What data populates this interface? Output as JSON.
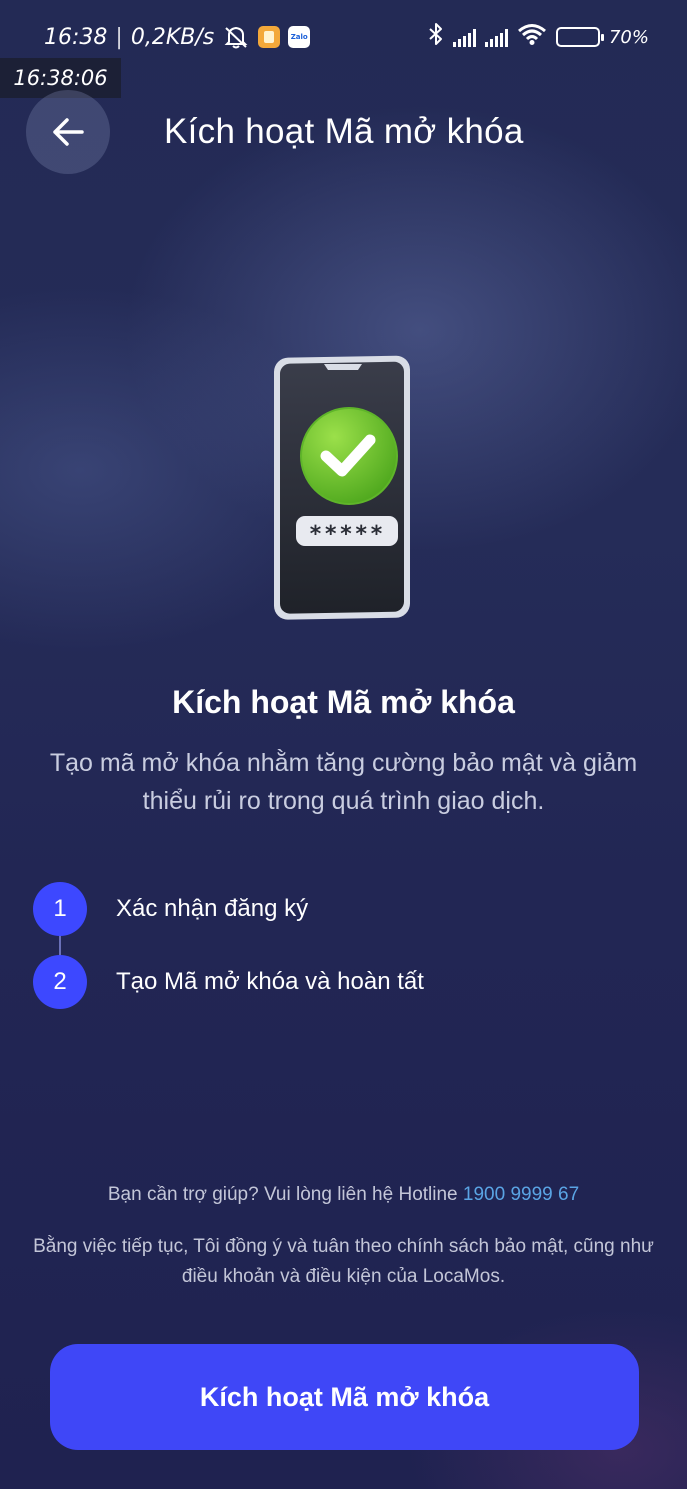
{
  "status_bar": {
    "time": "16:38",
    "separator": "|",
    "network_speed": "0,2KB/s",
    "battery_percent": "70%",
    "battery_level": 0.7,
    "zalo_label": "Zalo",
    "icons": [
      "mute-icon",
      "app-icon-orange",
      "zalo-icon",
      "bluetooth-icon",
      "signal-icon",
      "signal-icon",
      "wifi-icon",
      "battery-icon"
    ]
  },
  "time_overlay": "16:38:06",
  "header": {
    "title": "Kích hoạt Mã mở khóa",
    "back_icon": "arrow-left-icon"
  },
  "illustration": {
    "icon": "phone-check-icon",
    "pin_mask": "*****"
  },
  "main": {
    "title": "Kích hoạt Mã mở khóa",
    "description": "Tạo mã mở khóa nhằm tăng cường bảo mật và giảm thiểu rủi ro trong quá trình giao dịch."
  },
  "steps": [
    {
      "number": "1",
      "label": "Xác nhận đăng ký"
    },
    {
      "number": "2",
      "label": "Tạo Mã mở khóa và hoàn tất"
    }
  ],
  "footer": {
    "help_text": "Bạn cần trợ giúp? Vui lòng liên hệ Hotline",
    "hotline": "1900 9999 67",
    "terms": "Bằng việc tiếp tục, Tôi đồng ý và tuân theo chính sách bảo mật, cũng như điều khoản và điều kiện của LocaMos."
  },
  "cta": {
    "label": "Kích hoạt Mã mở khóa"
  },
  "colors": {
    "accent": "#3f47f7",
    "step_circle": "#3d48ff",
    "hotline": "#5aa4e4",
    "check_green": "#7cc934"
  }
}
